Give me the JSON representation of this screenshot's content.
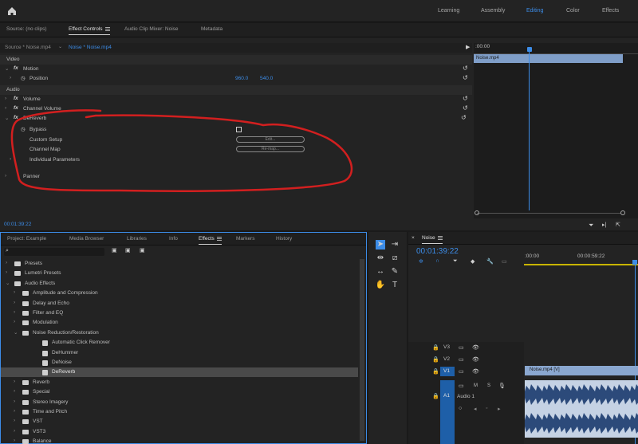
{
  "workspaces": {
    "learning": "Learning",
    "assembly": "Assembly",
    "editing": "Editing",
    "color": "Color",
    "effects": "Effects"
  },
  "source_panel": {
    "tabs": [
      "Source: (no clips)",
      "Effect Controls",
      "Audio Clip Mixer: Noise",
      "Metadata"
    ],
    "source_clip": "Source * Noise.mp4",
    "seq_clip": "Noise * Noise.mp4",
    "timeline_ruler": ":00:00",
    "clip_label": "Noise.mp4",
    "sections": {
      "video": "Video",
      "motion": "Motion",
      "position": "Position",
      "position_x": "960.0",
      "position_y": "540.0",
      "audio": "Audio",
      "volume": "Volume",
      "channel_volume": "Channel Volume",
      "dereverb": "DeReverb",
      "bypass": "Bypass",
      "custom_setup": "Custom Setup",
      "edit_btn": "Edit...",
      "channel_map": "Channel Map",
      "remap_btn": "Re-map...",
      "individual_params": "Individual Parameters",
      "panner": "Panner"
    },
    "timecode": "00:01:39:22"
  },
  "project_panel": {
    "tabs": [
      "Project: Example",
      "Media Browser",
      "Libraries",
      "Info",
      "Effects",
      "Markers",
      "History"
    ],
    "search_placeholder": "",
    "items": [
      {
        "label": "Presets",
        "indent": 0,
        "type": "folder-star"
      },
      {
        "label": "Lumetri Presets",
        "indent": 0,
        "type": "folder-star"
      },
      {
        "label": "Audio Effects",
        "indent": 0,
        "type": "folder",
        "open": true
      },
      {
        "label": "Amplitude and Compression",
        "indent": 1,
        "type": "folder"
      },
      {
        "label": "Delay and Echo",
        "indent": 1,
        "type": "folder"
      },
      {
        "label": "Filter and EQ",
        "indent": 1,
        "type": "folder"
      },
      {
        "label": "Modulation",
        "indent": 1,
        "type": "folder"
      },
      {
        "label": "Noise Reduction/Restoration",
        "indent": 1,
        "type": "folder",
        "open": true
      },
      {
        "label": "Automatic Click Remover",
        "indent": 2,
        "type": "fx"
      },
      {
        "label": "DeHummer",
        "indent": 2,
        "type": "fx"
      },
      {
        "label": "DeNoise",
        "indent": 2,
        "type": "fx"
      },
      {
        "label": "DeReverb",
        "indent": 2,
        "type": "fx",
        "selected": true
      },
      {
        "label": "Reverb",
        "indent": 1,
        "type": "folder"
      },
      {
        "label": "Special",
        "indent": 1,
        "type": "folder"
      },
      {
        "label": "Stereo Imagery",
        "indent": 1,
        "type": "folder"
      },
      {
        "label": "Time and Pitch",
        "indent": 1,
        "type": "folder"
      },
      {
        "label": "VST",
        "indent": 1,
        "type": "folder"
      },
      {
        "label": "VST3",
        "indent": 1,
        "type": "folder"
      },
      {
        "label": "Balance",
        "indent": 1,
        "type": "folder"
      }
    ]
  },
  "timeline": {
    "sequence_name": "Noise",
    "timecode": "00:01:39:22",
    "ruler_start": ":00:00",
    "ruler_mid": "00:00:59:22",
    "tracks": {
      "v3": "V3",
      "v2": "V2",
      "v1": "V1",
      "a1": "A1",
      "audio1": "Audio 1"
    },
    "clip_video": "Noise.mp4 [V]"
  },
  "colors": {
    "accent": "#3c8ce7",
    "annotation": "#d21f1f"
  }
}
